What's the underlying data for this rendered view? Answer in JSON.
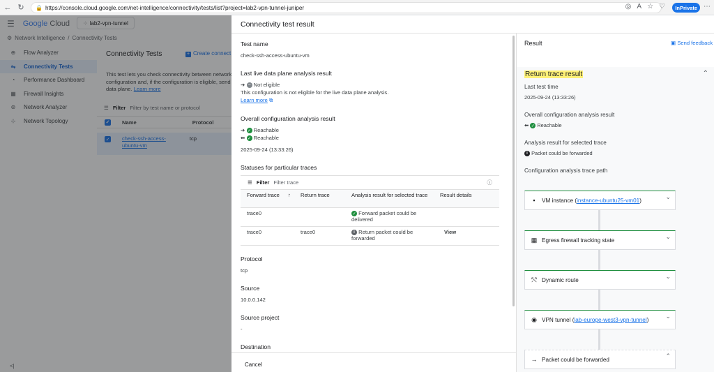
{
  "browser": {
    "url": "https://console.cloud.google.com/net-intelligence/connectivity/tests/list?project=lab2-vpn-tunnel-juniper",
    "inprivate_label": "InPrivate"
  },
  "header": {
    "logo_google": "Google",
    "logo_cloud": "Cloud",
    "project": "lab2-vpn-tunnel"
  },
  "breadcrumb": {
    "root": "Network Intelligence",
    "sep": "/",
    "current": "Connectivity Tests"
  },
  "sidebar": {
    "items": [
      {
        "label": "Flow Analyzer",
        "icon": "flow-analyzer-icon"
      },
      {
        "label": "Connectivity Tests",
        "icon": "connectivity-tests-icon",
        "active": true
      },
      {
        "label": "Performance Dashboard",
        "icon": "performance-dashboard-icon"
      },
      {
        "label": "Firewall Insights",
        "icon": "firewall-insights-icon"
      },
      {
        "label": "Network Analyzer",
        "icon": "network-analyzer-icon"
      },
      {
        "label": "Network Topology",
        "icon": "network-topology-icon"
      }
    ],
    "collapse": "<|"
  },
  "behind": {
    "title": "Connectivity Tests",
    "create": "Create connect",
    "desc1": "This test lets you check connectivity between network",
    "desc2": "configuration and, if the configuration is eligible, send",
    "desc3": "data plane.",
    "learn_more": "Learn more",
    "filter_label": "Filter",
    "filter_placeholder": "Filter by test name or protocol",
    "col_name": "Name",
    "col_protocol": "Protocol",
    "row_name_1": "check-ssh-access-",
    "row_name_2": "ubuntu-vm",
    "row_protocol": "tcp"
  },
  "panel": {
    "title": "Connectivity test result",
    "test_name_label": "Test name",
    "test_name": "check-ssh-access-ubuntu-vm",
    "live_label": "Last live data plane analysis result",
    "live_status": "Not eligible",
    "live_desc": "This configuration is not eligible for the live data plane analysis.",
    "learn_more": "Learn more",
    "config_label": "Overall configuration analysis result",
    "reachable_1": "Reachable",
    "reachable_2": "Reachable",
    "config_time": "2025-09-24 (13:33:26)",
    "statuses_label": "Statuses for particular traces",
    "filter_label": "Filter",
    "filter_placeholder": "Filter trace",
    "table": {
      "col_forward": "Forward trace",
      "col_return": "Return trace",
      "col_analysis": "Analysis result for selected trace",
      "col_details": "Result details",
      "rows": [
        {
          "forward": "trace0",
          "return": "",
          "analysis": "Forward packet could be delivered",
          "details": ""
        },
        {
          "forward": "trace0",
          "return": "trace0",
          "analysis": "Return packet could be forwarded",
          "details": "View"
        }
      ]
    },
    "protocol_label": "Protocol",
    "protocol": "tcp",
    "source_label": "Source",
    "source": "10.0.0.142",
    "source_project_label": "Source project",
    "source_project": "-",
    "destination_label": "Destination",
    "cancel": "Cancel"
  },
  "result": {
    "title": "Result",
    "feedback": "Send feedback",
    "section_title": "Return trace result",
    "last_time_label": "Last test time",
    "last_time": "2025-09-24 (13:33:26)",
    "overall_label": "Overall configuration analysis result",
    "overall_value": "Reachable",
    "selected_label": "Analysis result for selected trace",
    "selected_value": "Packet could be forwarded",
    "path_label": "Configuration analysis trace path",
    "steps": [
      {
        "prefix": "VM instance (",
        "link": "instance-ubuntu25-vm01",
        "suffix": ")",
        "icon": "vm-instance-icon"
      },
      {
        "prefix": "Egress firewall tracking state",
        "link": "",
        "suffix": "",
        "icon": "firewall-icon"
      },
      {
        "prefix": "Dynamic route",
        "link": "",
        "suffix": "",
        "icon": "route-icon"
      },
      {
        "prefix": "VPN tunnel (",
        "link": "lab-europe-west3-vpn-tunnel",
        "suffix": ")",
        "icon": "globe-icon"
      },
      {
        "prefix": "Packet could be forwarded",
        "link": "",
        "suffix": "",
        "icon": "arrow-right-icon"
      }
    ]
  }
}
